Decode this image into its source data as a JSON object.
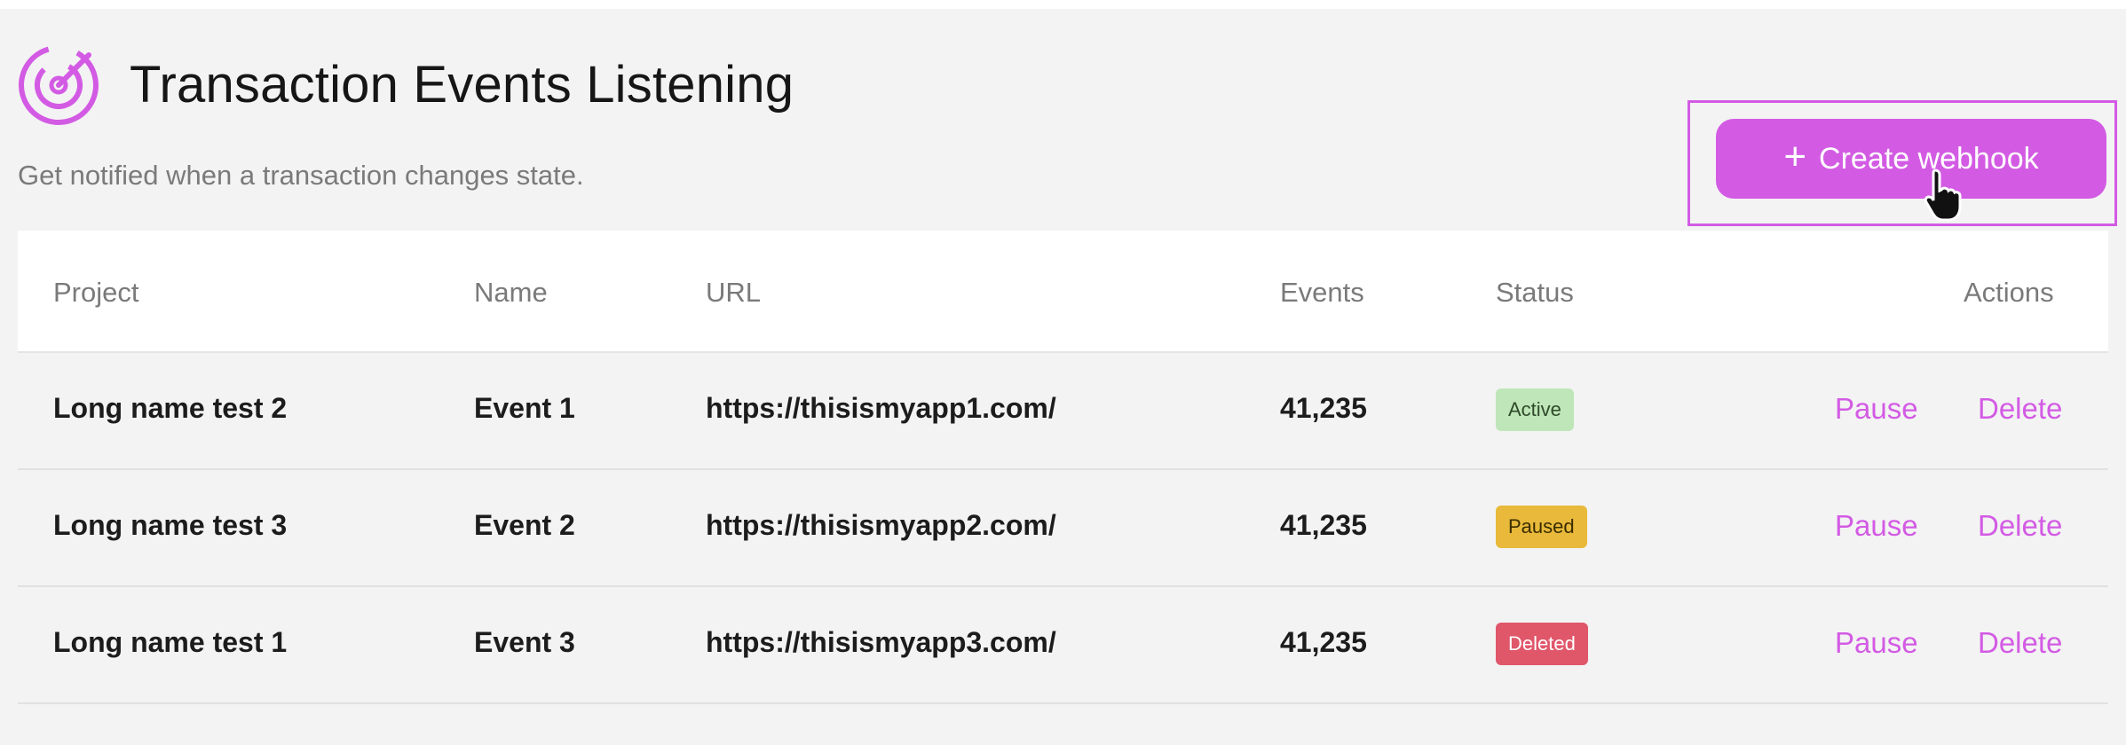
{
  "header": {
    "title": "Transaction Events Listening",
    "subtitle": "Get notified when a transaction changes state.",
    "create_button_label": "Create webhook",
    "accent_color": "#d35be4"
  },
  "table": {
    "columns": {
      "project": "Project",
      "name": "Name",
      "url": "URL",
      "events": "Events",
      "status": "Status",
      "actions": "Actions"
    },
    "rows": [
      {
        "project": "Long name test 2",
        "name": "Event 1",
        "url": "https://thisismyapp1.com/",
        "events": "41,235",
        "status": "Active",
        "status_color": "#bfe6b8",
        "status_text_color": "#2e4a2a",
        "pause_label": "Pause",
        "delete_label": "Delete"
      },
      {
        "project": "Long name test 3",
        "name": "Event 2",
        "url": "https://thisismyapp2.com/",
        "events": "41,235",
        "status": "Paused",
        "status_color": "#e8b93a",
        "status_text_color": "#3a2c00",
        "pause_label": "Pause",
        "delete_label": "Delete"
      },
      {
        "project": "Long name test 1",
        "name": "Event 3",
        "url": "https://thisismyapp3.com/",
        "events": "41,235",
        "status": "Deleted",
        "status_color": "#e0576a",
        "status_text_color": "#ffffff",
        "pause_label": "Pause",
        "delete_label": "Delete"
      }
    ]
  },
  "icons": {
    "logo": "radar-target-icon",
    "create": "plus-icon",
    "pointer": "hand-pointer-icon"
  }
}
